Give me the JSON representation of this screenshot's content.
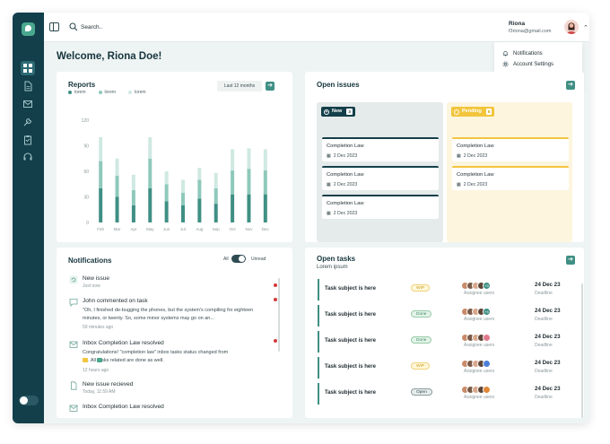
{
  "header": {
    "search_placeholder": "Search..",
    "user_name": "Riona",
    "user_email": "f3riona@gmail.com"
  },
  "profile_menu": {
    "items": [
      {
        "label": "Notifications",
        "icon": "bell-icon"
      },
      {
        "label": "Account Settings",
        "icon": "gear-icon"
      }
    ]
  },
  "welcome": "Welcome, Riona Doe!",
  "sidebar": {
    "icons": [
      "dashboard-icon",
      "document-icon",
      "mail-icon",
      "wrench-icon",
      "clipboard-icon",
      "headset-icon"
    ]
  },
  "reports": {
    "title": "Reports",
    "period": "Last 12 months",
    "legend": [
      "lorem",
      "lorem",
      "lorem"
    ]
  },
  "chart_data": {
    "type": "bar",
    "stacked": true,
    "categories": [
      "Feb",
      "Mar",
      "Apr",
      "May",
      "Jun",
      "Jul",
      "Aug",
      "Sep",
      "Oct",
      "Nov",
      "Dec"
    ],
    "series": [
      {
        "name": "lorem",
        "values": [
          40,
          30,
          20,
          40,
          25,
          20,
          28,
          22,
          33,
          33,
          33
        ]
      },
      {
        "name": "lorem",
        "values": [
          32,
          25,
          18,
          35,
          20,
          15,
          22,
          18,
          28,
          30,
          28
        ]
      },
      {
        "name": "lorem",
        "values": [
          28,
          20,
          18,
          25,
          15,
          15,
          14,
          18,
          25,
          24,
          25
        ]
      }
    ],
    "yticks": [
      0,
      30,
      60,
      90,
      120
    ],
    "ylim": [
      0,
      120
    ],
    "colors": [
      "#3f8f84",
      "#8ec9bb",
      "#cfe9e2"
    ]
  },
  "open_issues": {
    "title": "Open issues",
    "columns": [
      {
        "label": "New",
        "count": "3",
        "icon": "plus-circle-icon",
        "items": [
          {
            "title": "Completion Law",
            "date": "2 Dec 2023"
          },
          {
            "title": "Completion Law",
            "date": "2 Dec 2023"
          },
          {
            "title": "Completion Law",
            "date": "2 Dec 2023"
          }
        ]
      },
      {
        "label": "Pending",
        "count": "5",
        "icon": "clock-icon",
        "items": [
          {
            "title": "Completion Law",
            "date": "2 Dec 2023"
          },
          {
            "title": "Completion Law",
            "date": "2 Dec 2023"
          }
        ]
      }
    ]
  },
  "notifications": {
    "title": "Notifications",
    "filter_all": "All",
    "filter_unread": "Unread",
    "items": [
      {
        "title": "New issue",
        "body": "",
        "time": "Just now",
        "icon": "refresh-icon"
      },
      {
        "title": "John commented on task",
        "body": "\"Oh, I finished de-bugging the phones, but the system's compiling for eighteen minutes, or twenty.  So, some minor systems may go on an...",
        "time": "59 minutes ago",
        "icon": "comment-icon"
      },
      {
        "title": "Inbox Completion Law resolved",
        "body": "Congratulations! \"completion law\" inbox tasks status changed from",
        "body2": "to      . All tasks related are done as well.",
        "time": "12 hours ago",
        "icon": "inbox-icon"
      },
      {
        "title": "New issue recieved",
        "body": "",
        "time": "Today, 11:59 AM",
        "icon": "document-icon"
      },
      {
        "title": "Inbox Completion Law resolved",
        "body": "",
        "time": "",
        "icon": "inbox-icon"
      }
    ]
  },
  "open_tasks": {
    "title": "Open tasks",
    "subtitle": "Lorem ipsum",
    "assignee_label": "Assignee users",
    "deadline_label": "Deadline",
    "rows": [
      {
        "subject": "Task subject is here",
        "status": "WIP",
        "kind": "wip",
        "more": "+3",
        "more_color": "#3f8f84",
        "date": "24 Dec 23"
      },
      {
        "subject": "Task subject is here",
        "status": "Done",
        "kind": "done",
        "more": "+4",
        "more_color": "#3f8f84",
        "date": "24 Dec 23"
      },
      {
        "subject": "Task subject is here",
        "status": "Done",
        "kind": "done",
        "more": "",
        "more_color": "#e07a8c",
        "date": "24 Dec 23"
      },
      {
        "subject": "Task subject is here",
        "status": "WIP",
        "kind": "wip",
        "more": "",
        "more_color": "#4c7fd6",
        "date": "24 Dec 23"
      },
      {
        "subject": "Task subject is here",
        "status": "Open",
        "kind": "open",
        "more": "",
        "more_color": "#e0883a",
        "date": "24 Dec 23"
      }
    ]
  }
}
